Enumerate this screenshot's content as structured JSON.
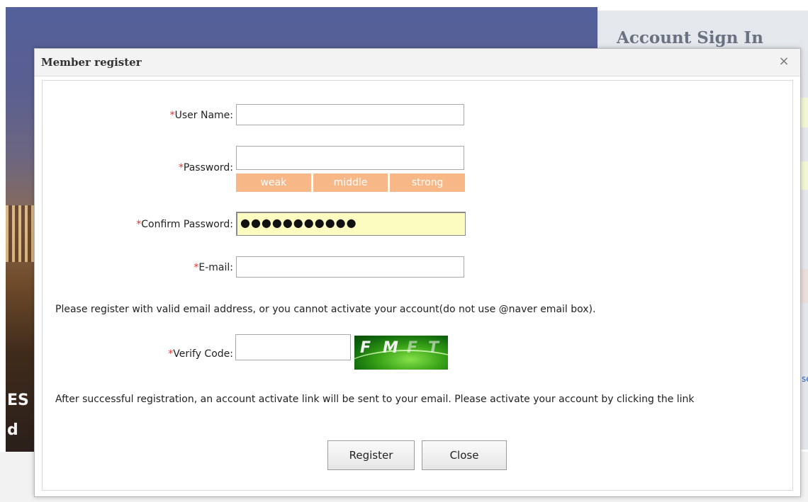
{
  "background": {
    "panel_title": "Account Sign In",
    "hero_line1": "ES",
    "hero_line2": "d",
    "panel_link": "se"
  },
  "dialog": {
    "title": "Member register",
    "close_glyph": "×"
  },
  "form": {
    "required_mark": "*",
    "username": {
      "label": "User Name:",
      "value": ""
    },
    "password": {
      "label": "Password:",
      "value": ""
    },
    "strength": [
      "weak",
      "middle",
      "strong"
    ],
    "confirm_password": {
      "label": "Confirm Password:",
      "value": "●●●●●●●●●●●"
    },
    "email": {
      "label": "E-mail:",
      "value": ""
    },
    "email_note": "Please register with valid email address, or you cannot activate your account(do not use @naver email box).",
    "verify_code": {
      "label": "Verify Code:",
      "value": ""
    },
    "captcha_chars": [
      "F",
      "M",
      "F",
      "T"
    ],
    "activation_note": "After successful registration, an account activate link will be sent to your email. Please activate your account by clicking the link"
  },
  "buttons": {
    "register": "Register",
    "close": "Close"
  }
}
